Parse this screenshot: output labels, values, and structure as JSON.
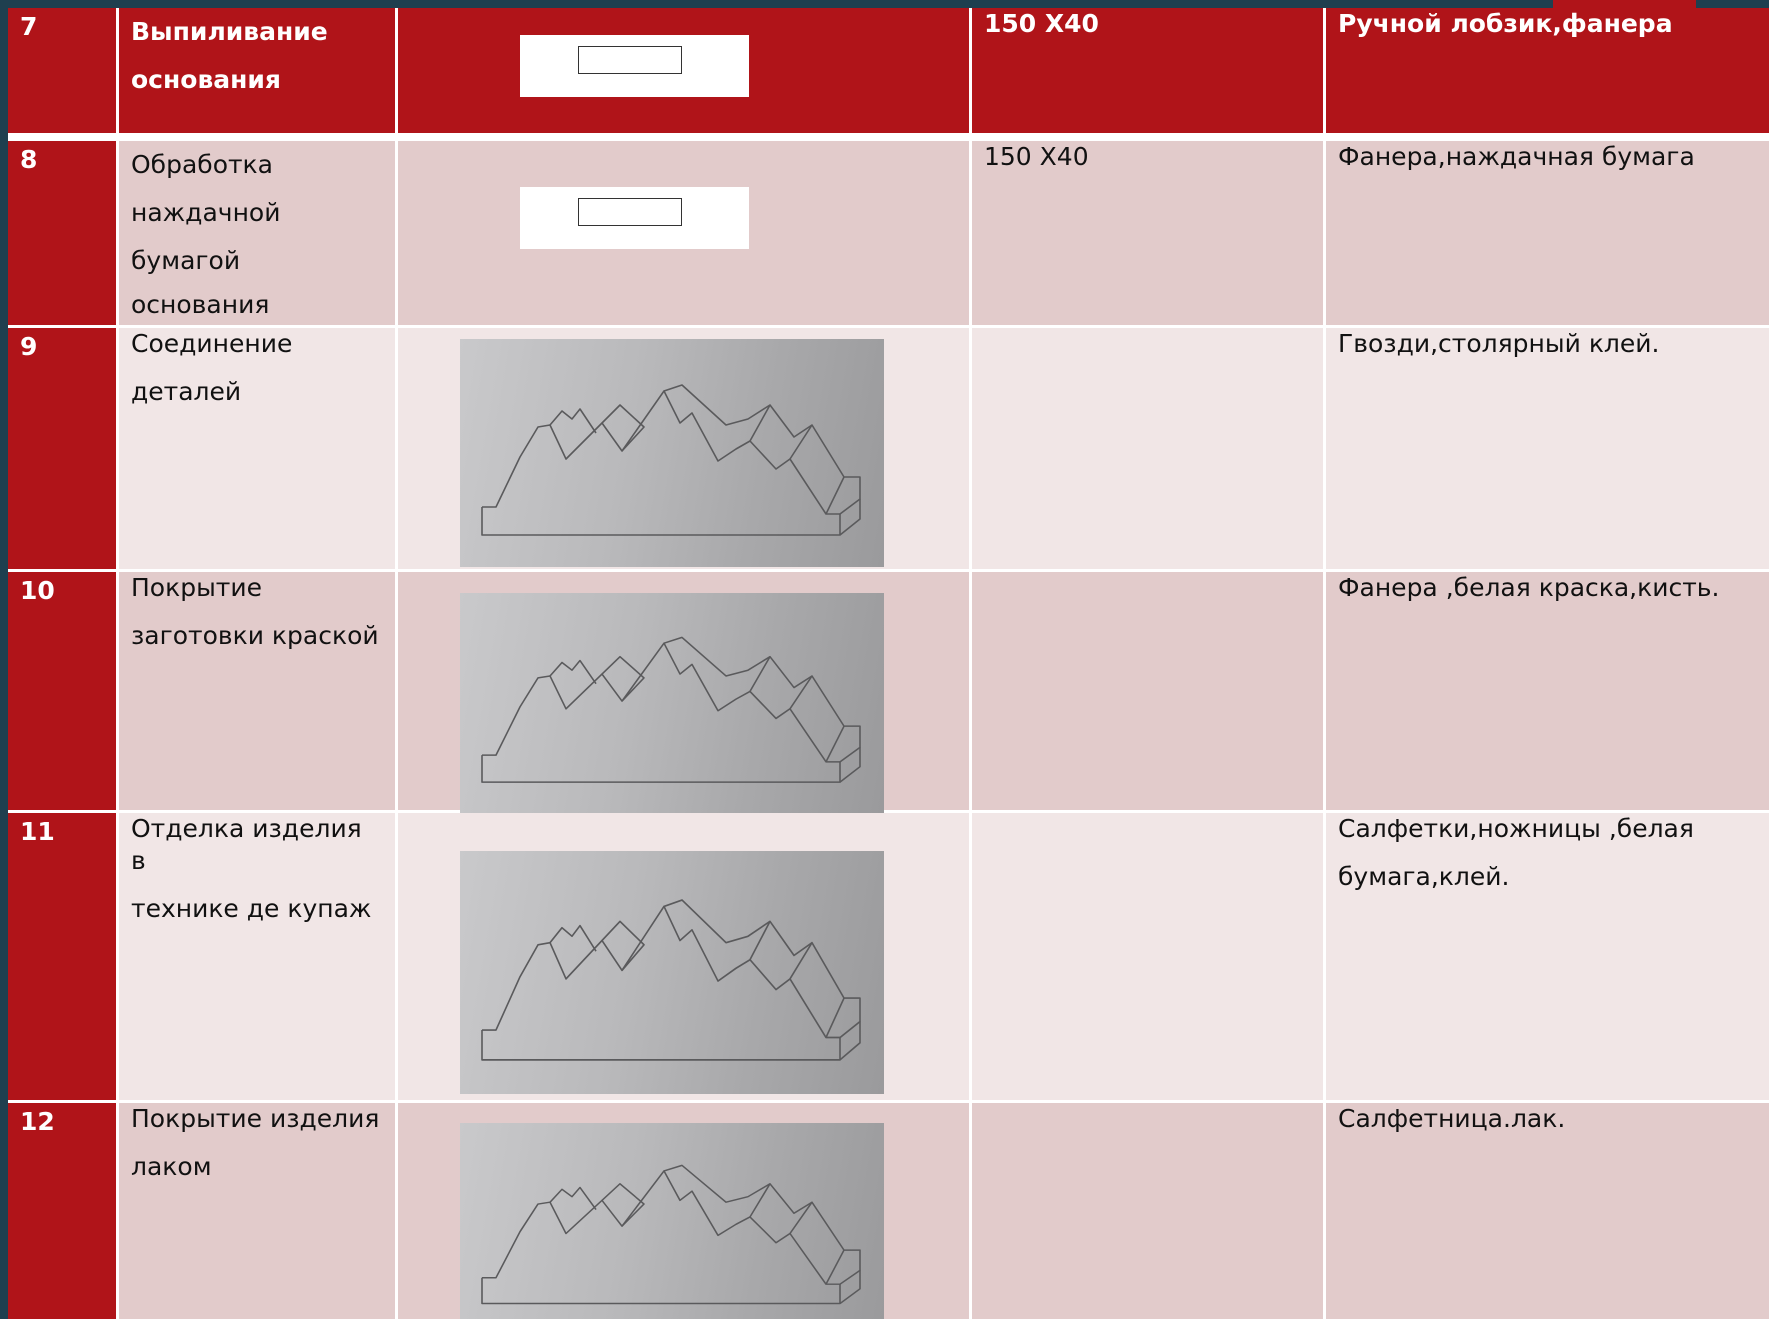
{
  "colors": {
    "accent_red": "#b01419",
    "row_pink": "#e2cbcb",
    "row_light": "#f1e6e6",
    "frame": "#1f3f4f"
  },
  "rows": [
    {
      "num": "7",
      "operation": [
        "Выпиливание",
        "основания"
      ],
      "size": "150 Х40",
      "materials": [
        "Ручной лобзик,фанера"
      ],
      "image": "rectangle-sketch"
    },
    {
      "num": "8",
      "operation": [
        "Обработка",
        "наждачной",
        "бумагой",
        "основания"
      ],
      "size": "150 Х40",
      "materials": [
        "Фанера,наждачная бумага"
      ],
      "image": "rectangle-sketch"
    },
    {
      "num": "9",
      "operation": [
        "Соединение",
        "деталей"
      ],
      "size": "",
      "materials": [
        "Гвозди,столярный клей."
      ],
      "image": "napkin-holder-sketch-photo"
    },
    {
      "num": "10",
      "operation": [
        "Покрытие",
        "заготовки краской"
      ],
      "size": "",
      "materials": [
        "Фанера ,белая краска,кисть."
      ],
      "image": "napkin-holder-sketch-photo"
    },
    {
      "num": "11",
      "operation": [
        "Отделка изделия в",
        "технике де купаж"
      ],
      "size": "",
      "materials": [
        "Салфетки,ножницы ,белая",
        "бумага,клей."
      ],
      "image": "napkin-holder-sketch-photo"
    },
    {
      "num": "12",
      "operation": [
        "Покрытие изделия",
        "лаком"
      ],
      "size": "",
      "materials": [
        "Салфетница.лак."
      ],
      "image": "napkin-holder-sketch-photo"
    }
  ]
}
